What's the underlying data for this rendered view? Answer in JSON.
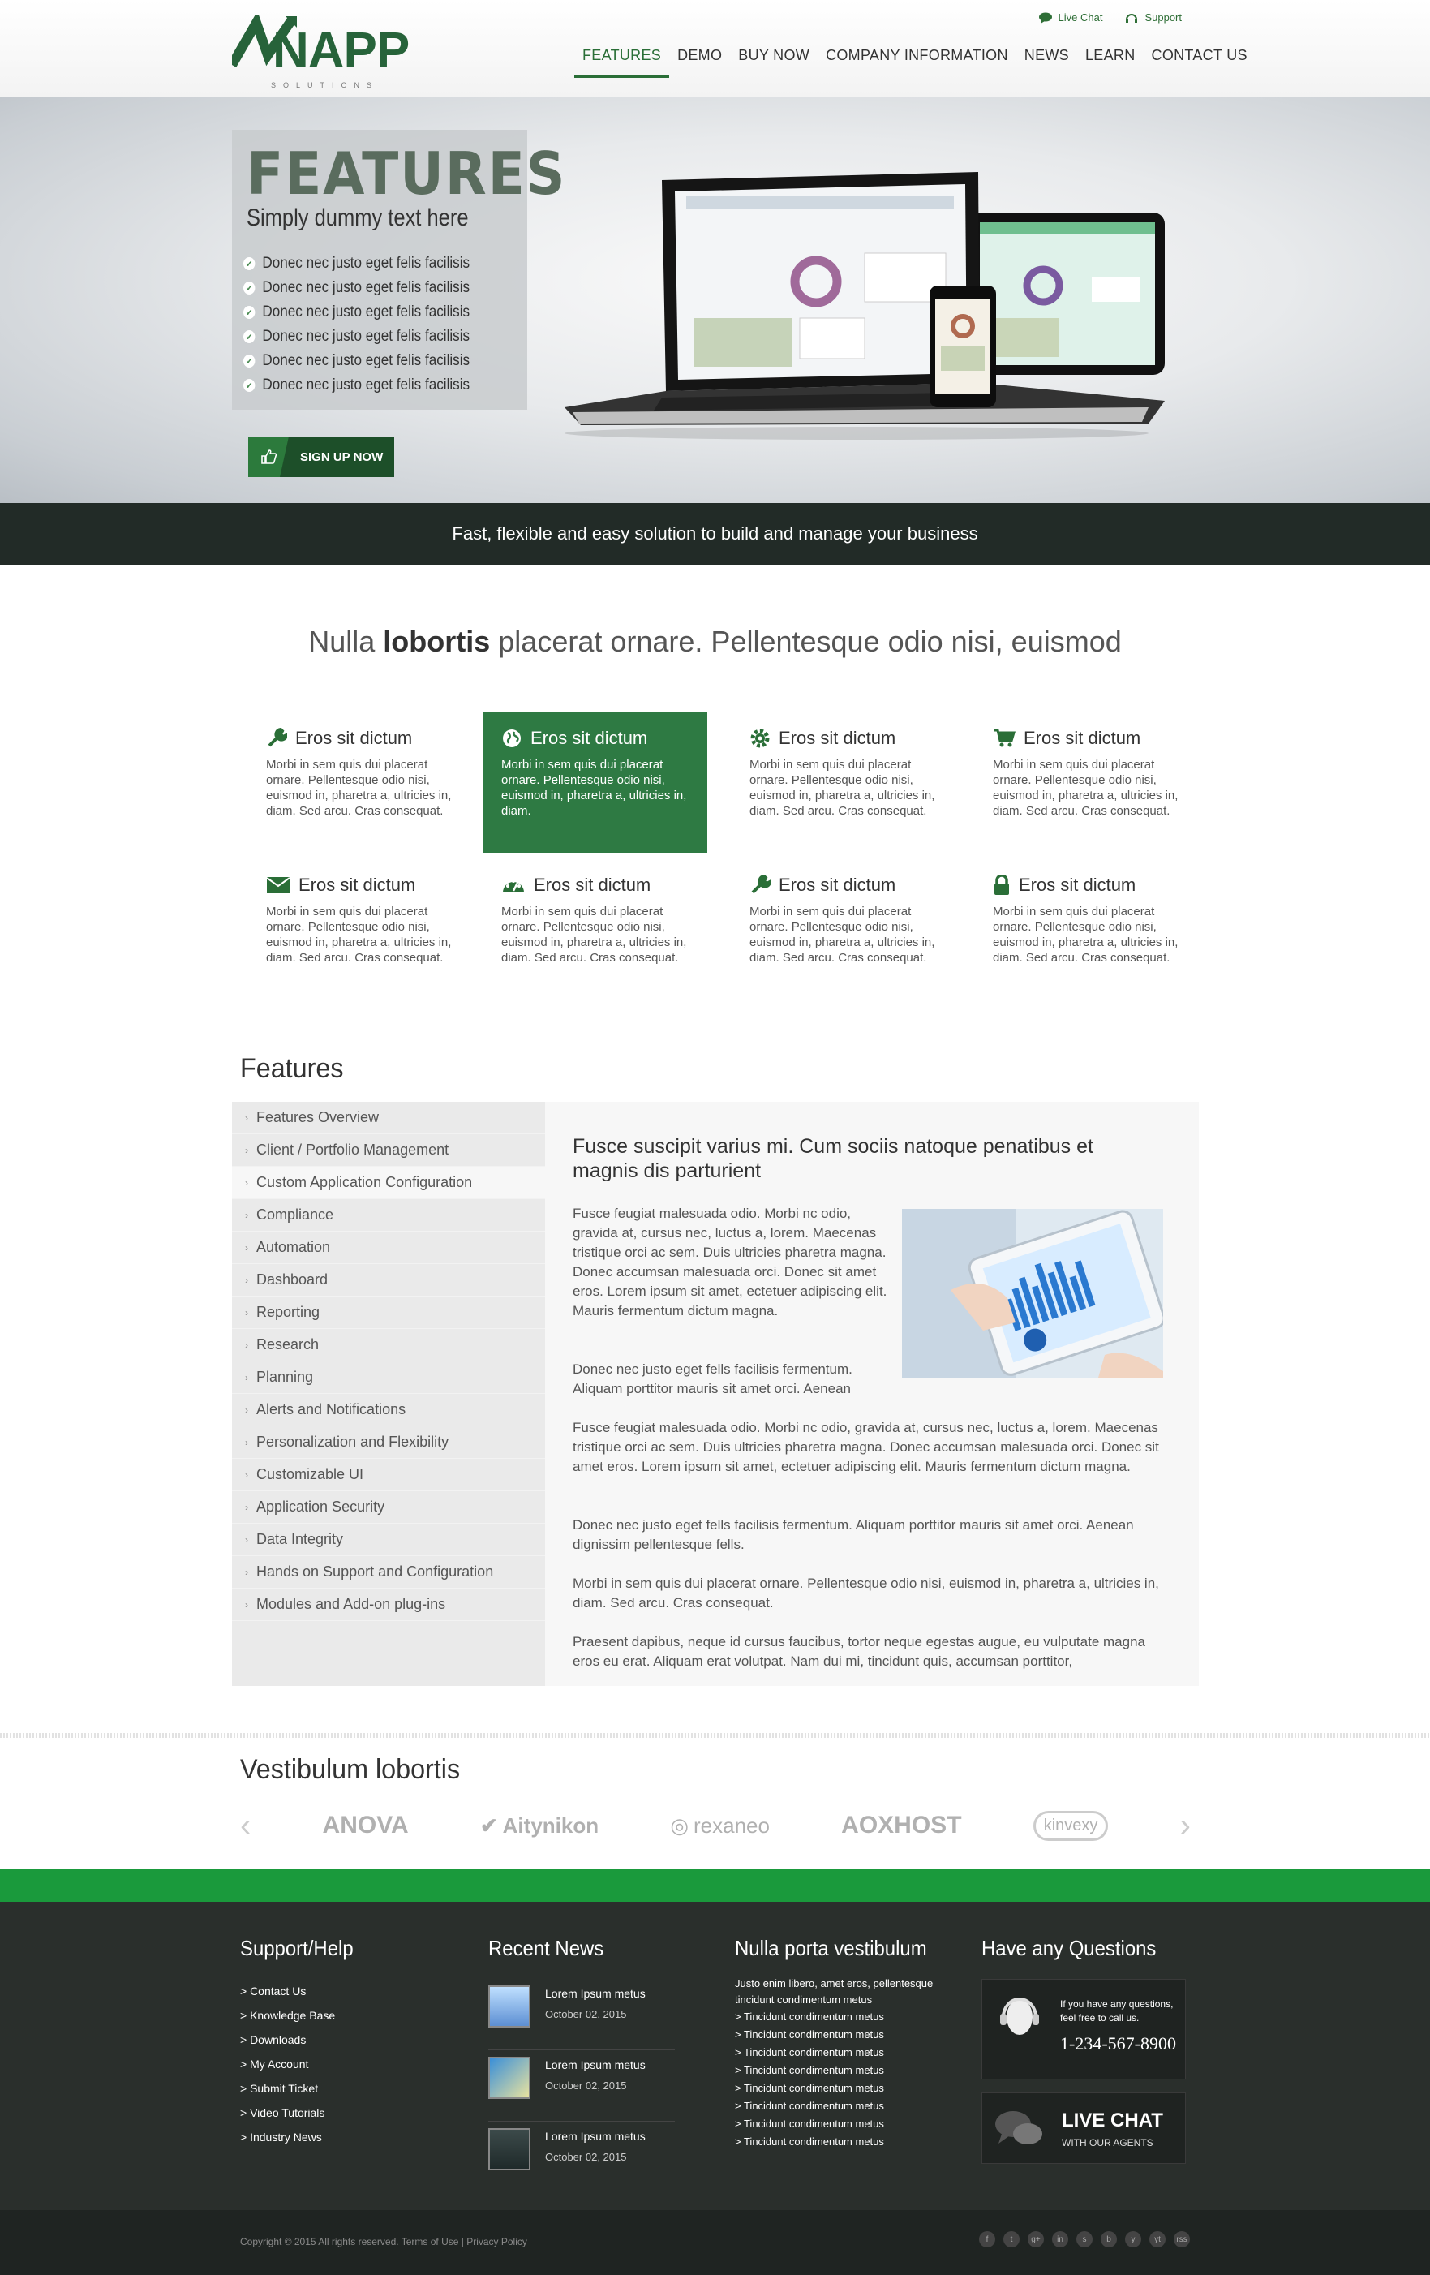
{
  "header": {
    "logo_text": "NAPP",
    "logo_sub": "SOLUTIONS",
    "top_links": [
      "Live Chat",
      "Support"
    ],
    "nav": [
      "FEATURES",
      "DEMO",
      "BUY NOW",
      "COMPANY INFORMATION",
      "NEWS",
      "LEARN",
      "CONTACT US"
    ],
    "active_nav": "FEATURES"
  },
  "hero": {
    "title": "FEATURES",
    "subtitle": "Simply dummy text here",
    "bullets": [
      "Donec nec justo eget felis facilisis",
      "Donec nec justo eget felis facilisis",
      "Donec nec justo eget felis facilisis",
      "Donec nec justo eget felis facilisis",
      "Donec nec justo eget felis facilisis",
      "Donec nec justo eget felis facilisis"
    ],
    "cta": "SIGN UP NOW",
    "tagline": "Fast, flexible and easy solution to build and manage your business"
  },
  "intro": {
    "pre": "Nulla ",
    "bold": "lobortis",
    "post": " placerat ornare. Pellentesque odio nisi, euismod"
  },
  "features": [
    {
      "icon": "wrench-icon",
      "title": "Eros sit dictum",
      "text": "Morbi in sem quis dui placerat ornare. Pellentesque odio nisi, euismod in, pharetra a, ultricies in, diam. Sed arcu. Cras consequat."
    },
    {
      "icon": "globe-icon",
      "title": "Eros sit dictum",
      "text": "Morbi in sem quis dui placerat ornare. Pellentesque odio nisi, euismod in, pharetra a, ultricies in, diam.",
      "highlighted": true
    },
    {
      "icon": "gear-icon",
      "title": "Eros sit dictum",
      "text": "Morbi in sem quis dui placerat ornare. Pellentesque odio nisi, euismod in, pharetra a, ultricies in, diam. Sed arcu. Cras consequat."
    },
    {
      "icon": "cart-icon",
      "title": "Eros sit dictum",
      "text": "Morbi in sem quis dui placerat ornare. Pellentesque odio nisi, euismod in, pharetra a, ultricies in, diam. Sed arcu. Cras consequat."
    },
    {
      "icon": "envelope-icon",
      "title": "Eros sit dictum",
      "text": "Morbi in sem quis dui placerat ornare. Pellentesque odio nisi, euismod in, pharetra a, ultricies in, diam. Sed arcu. Cras consequat."
    },
    {
      "icon": "dashboard-icon",
      "title": "Eros sit dictum",
      "text": "Morbi in sem quis dui placerat ornare. Pellentesque odio nisi, euismod in, pharetra a, ultricies in, diam. Sed arcu. Cras consequat."
    },
    {
      "icon": "wrench-icon",
      "title": "Eros sit dictum",
      "text": "Morbi in sem quis dui placerat ornare. Pellentesque odio nisi, euismod in, pharetra a, ultricies in, diam. Sed arcu. Cras consequat."
    },
    {
      "icon": "lock-icon",
      "title": "Eros sit dictum",
      "text": "Morbi in sem quis dui placerat ornare. Pellentesque odio nisi, euismod in, pharetra a, ultricies in, diam. Sed arcu. Cras consequat."
    }
  ],
  "features_section": {
    "heading": "Features",
    "menu": [
      "Features Overview",
      "Client / Portfolio Management",
      "Custom Application Configuration",
      "Compliance",
      "Automation",
      "Dashboard",
      "Reporting",
      "Research",
      "Planning",
      "Alerts and Notifications",
      "Personalization and Flexibility",
      "Customizable UI",
      "Application Security",
      "Data Integrity",
      "Hands on Support and Configuration",
      "Modules and Add-on plug-ins"
    ],
    "selected": "Custom Application Configuration",
    "content_title": "Fusce suscipit varius mi. Cum sociis natoque penatibus et magnis dis parturient",
    "paragraphs": [
      "Fusce feugiat malesuada odio. Morbi nc odio, gravida at, cursus nec, luctus a, lorem. Maecenas tristique orci ac sem. Duis ultricies pharetra magna. Donec accumsan malesuada orci. Donec sit amet eros. Lorem ipsum sit amet, ectetuer adipiscing elit. Mauris fermentum dictum magna.",
      "Donec nec justo eget fells facilisis fermentum. Aliquam porttitor mauris sit amet orci. Aenean",
      "Fusce feugiat malesuada odio. Morbi nc odio, gravida at, cursus nec, luctus a, lorem. Maecenas tristique orci ac sem. Duis ultricies pharetra magna. Donec accumsan malesuada orci. Donec sit amet eros. Lorem ipsum sit amet, ectetuer adipiscing elit. Mauris fermentum dictum magna.",
      "Donec nec justo eget fells facilisis fermentum. Aliquam porttitor mauris sit amet orci. Aenean dignissim pellentesque fells.",
      "Morbi in sem quis dui placerat ornare. Pellentesque odio nisi, euismod in, pharetra a, ultricies in, diam. Sed arcu. Cras consequat.",
      "Praesent dapibus, neque id cursus faucibus, tortor neque egestas augue, eu vulputate magna eros eu erat. Aliquam erat volutpat. Nam dui mi, tincidunt quis, accumsan porttitor,"
    ]
  },
  "clients": {
    "heading": "Vestibulum lobortis",
    "logos": [
      "ANOVA",
      "Aitynikon",
      "rexaneo",
      "AOXHOST",
      "kinvexy"
    ]
  },
  "footer": {
    "support": {
      "heading": "Support/Help",
      "links": [
        "> Contact Us",
        "> Knowledge Base",
        "> Downloads",
        "> My Account",
        "> Submit Ticket",
        "> Video Tutorials",
        "> Industry News"
      ]
    },
    "news": {
      "heading": "Recent News",
      "items": [
        {
          "title": "Lorem Ipsum metus",
          "date": "October 02, 2015"
        },
        {
          "title": "Lorem Ipsum metus",
          "date": "October 02, 2015"
        },
        {
          "title": "Lorem Ipsum metus",
          "date": "October 02, 2015"
        }
      ]
    },
    "porta": {
      "heading": "Nulla porta vestibulum",
      "intro": "Justo enim libero, amet eros, pellentesque tincidunt condimentum metus",
      "links": [
        "> Tincidunt condimentum metus",
        "> Tincidunt condimentum metus",
        "> Tincidunt condimentum metus",
        "> Tincidunt condimentum metus",
        "> Tincidunt condimentum metus",
        "> Tincidunt condimentum metus",
        "> Tincidunt condimentum metus",
        "> Tincidunt condimentum metus"
      ]
    },
    "questions": {
      "heading": "Have any Questions",
      "note": "If you have any questions, feel free to call us.",
      "phone": "1-234-567-8900",
      "chat_title": "LIVE CHAT",
      "chat_sub": "WITH OUR AGENTS"
    },
    "copyright": "Copyright © 2015 All rights reserved. Terms of Use | Privacy Policy",
    "social": [
      "f",
      "t",
      "g+",
      "in",
      "s",
      "b",
      "y",
      "yt",
      "rss"
    ]
  },
  "colors": {
    "brand_green": "#2a6e37",
    "footer_bar": "#1a9a3c",
    "footer_bg": "#2a2f2c"
  }
}
